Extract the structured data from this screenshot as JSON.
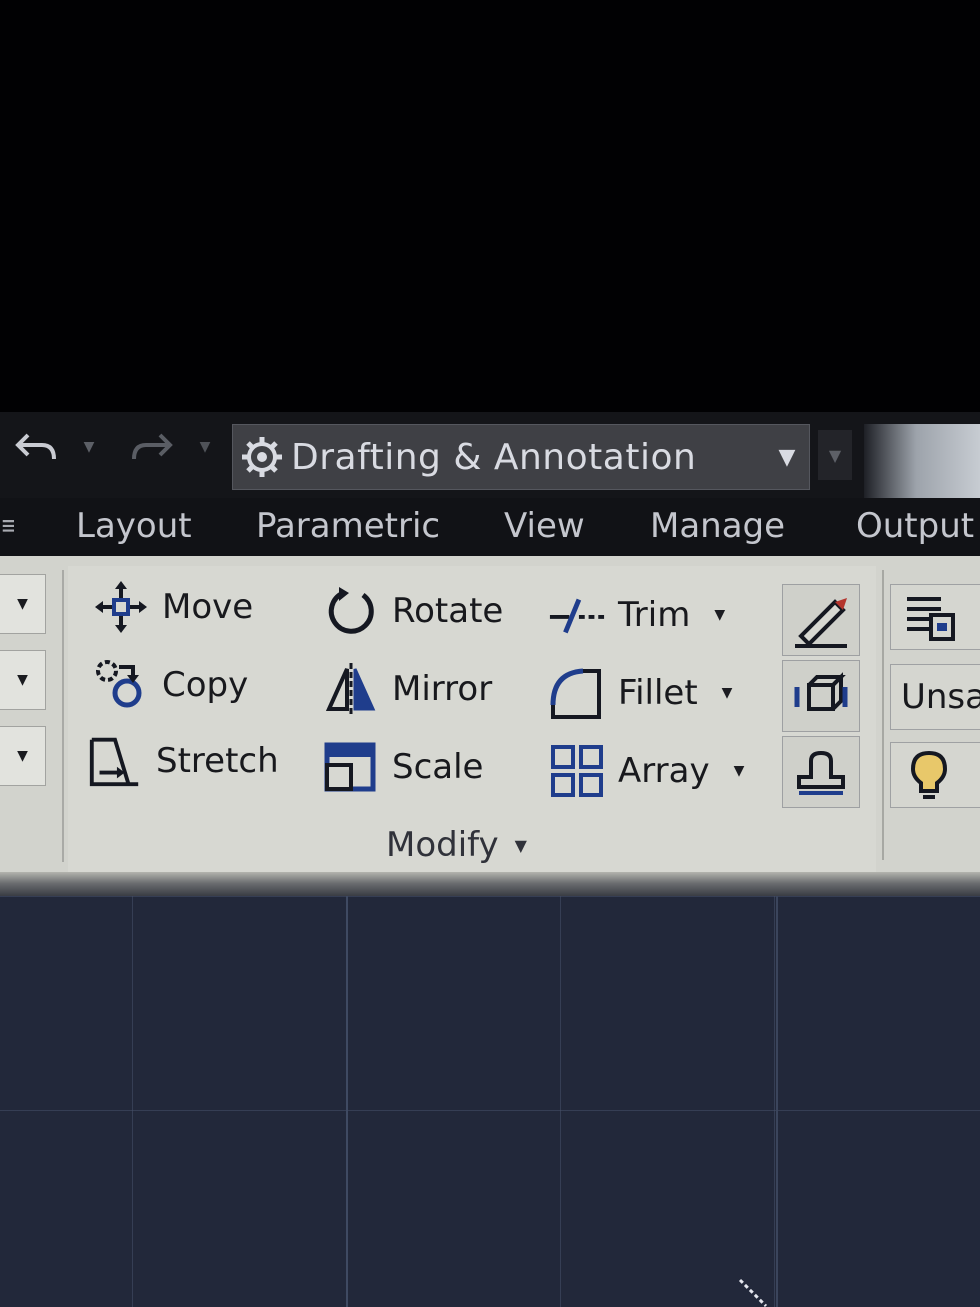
{
  "quick_access": {
    "workspace_label": "Drafting & Annotation"
  },
  "tabs": [
    "Layout",
    "Parametric",
    "View",
    "Manage",
    "Output"
  ],
  "modify_panel": {
    "title": "Modify",
    "tools": {
      "move": "Move",
      "copy": "Copy",
      "stretch": "Stretch",
      "rotate": "Rotate",
      "mirror": "Mirror",
      "scale": "Scale",
      "trim": "Trim",
      "fillet": "Fillet",
      "array": "Array"
    }
  },
  "right_panel": {
    "save_label": "Unsa"
  },
  "icons": {
    "undo": "undo-icon",
    "redo": "redo-icon",
    "gear": "gear-icon",
    "move": "move-icon",
    "copy": "copy-icon",
    "stretch": "stretch-icon",
    "rotate": "rotate-icon",
    "mirror": "mirror-icon",
    "scale": "scale-icon",
    "trim": "trim-icon",
    "fillet": "fillet-icon",
    "array": "array-icon",
    "draw": "pencil-icon",
    "block": "block-icon",
    "edit": "edit-icon",
    "layer": "layer-icon",
    "light": "lightbulb-icon"
  },
  "colors": {
    "ribbon_bg": "#d2d3cd",
    "tab_bar_bg": "#111216",
    "canvas_bg": "#22283a",
    "icon_blue": "#1f3d8c"
  }
}
